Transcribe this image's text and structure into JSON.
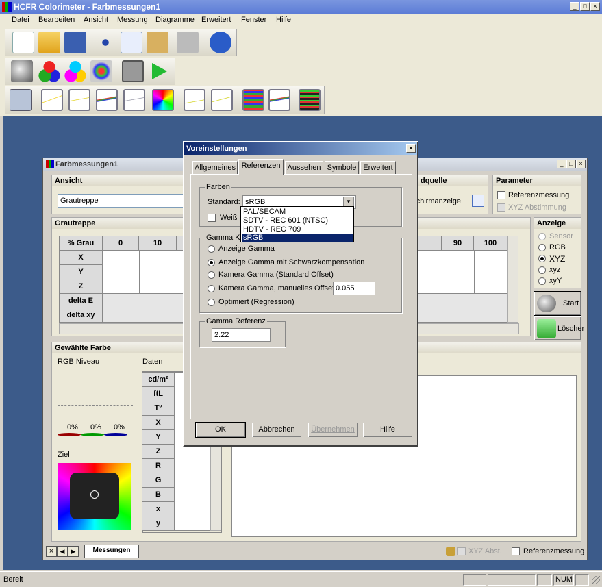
{
  "app": {
    "title": "HCFR Colorimeter - Farbmessungen1",
    "win_min": "_",
    "win_max": "□",
    "win_close": "×"
  },
  "menu": [
    "Datei",
    "Bearbeiten",
    "Ansicht",
    "Messung",
    "Diagramme",
    "Erweitert",
    "Fenster",
    "Hilfe"
  ],
  "toolbar1": [
    "new-file-icon",
    "open-folder-icon",
    "save-icon",
    "cut-icon",
    "copy-icon",
    "paste-icon",
    "print-icon",
    "help-icon"
  ],
  "toolbar2": [
    "sensor-icon",
    "primary-colors-icon",
    "secondary-colors-icon",
    "all-colors-icon",
    "camera-icon",
    "play-icon"
  ],
  "toolbar3": [
    "measurements-view-icon",
    "gamma-graph-icon",
    "rgb-graph-icon",
    "luminance-graph-icon",
    "colortemp-graph-icon",
    "cie-chart-icon",
    "deltae-graph-icon",
    "saturation-graph-icon",
    "near-black-graph-icon",
    "near-white-graph-icon",
    "spectrum-graph-icon"
  ],
  "child": {
    "title": "Farbmessungen1",
    "btn_min": "_",
    "btn_max": "□",
    "btn_close": "×"
  },
  "ansicht": {
    "header": "Ansicht",
    "value": "Grautreppe"
  },
  "quelle": {
    "header": "dquelle",
    "label": "dschirmanzeige"
  },
  "parameter": {
    "header": "Parameter",
    "ref": "Referenzmessung",
    "xyz": "XYZ Abstimmung"
  },
  "grautreppe": {
    "header": "Grautreppe",
    "columns": [
      "% Grau",
      "0",
      "10",
      "80",
      "90",
      "100"
    ],
    "rows": [
      "X",
      "Y",
      "Z",
      "delta E",
      "delta xy"
    ]
  },
  "anzeige": {
    "header": "Anzeige",
    "options": [
      "Sensor",
      "RGB",
      "XYZ",
      "xyz",
      "xyY"
    ],
    "selected": "XYZ"
  },
  "start_label": "Start",
  "clear_label": "Löscher",
  "gewaehlte": {
    "header": "Gewählte Farbe",
    "rgb_niveau": "RGB Niveau",
    "daten": "Daten",
    "percents": [
      "0%",
      "0%",
      "0%"
    ],
    "ziel": "Ziel",
    "rows": [
      "cd/m²",
      "ftL",
      "T°",
      "X",
      "Y",
      "Z",
      "R",
      "G",
      "B",
      "x",
      "y"
    ]
  },
  "bottom": {
    "tab": "Messungen",
    "xyz_abst": "XYZ Abst.",
    "ref": "Referenzmessung"
  },
  "status": {
    "text": "Bereit",
    "num": "NUM"
  },
  "dialog": {
    "title": "Voreinstellungen",
    "close": "×",
    "tabs": [
      "Allgemeines",
      "Referenzen",
      "Aussehen",
      "Symbole",
      "Erweitert"
    ],
    "active_tab": "Referenzen",
    "farben": {
      "label": "Farben",
      "standard_label": "Standard:",
      "standard_value": "sRGB",
      "weiss_label": "Weiß a"
    },
    "dropdown": [
      "PAL/SECAM",
      "SDTV - REC 601 (NTSC)",
      "HDTV - REC 709",
      "sRGB"
    ],
    "gamma": {
      "label": "Gamma Ka",
      "options": [
        "Anzeige Gamma",
        "Anzeige Gamma mit Schwarzkompensation",
        "Kamera Gamma (Standard Offset)",
        "Kamera Gamma, manuelles Offset",
        "Optimiert (Regression)"
      ],
      "selected": "Anzeige Gamma mit Schwarzkompensation",
      "offset": "0.055"
    },
    "gamma_ref": {
      "label": "Gamma Referenz",
      "value": "2.22"
    },
    "buttons": {
      "ok": "OK",
      "cancel": "Abbrechen",
      "apply": "Übernehmen",
      "help": "Hilfe"
    }
  }
}
